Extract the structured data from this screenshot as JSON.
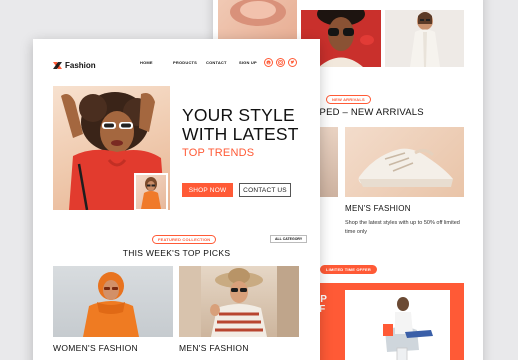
{
  "brand": {
    "name": "Fashion",
    "accent": "#ff5a36"
  },
  "nav": [
    "HOME",
    "PRODUCTS",
    "CONTACT",
    "SIGN UP"
  ],
  "socials": [
    "pinterest-icon",
    "instagram-icon",
    "twitter-icon"
  ],
  "hero": {
    "headline_line1": "YOUR STYLE",
    "headline_line2": "WITH LATEST",
    "subhead": "TOP TRENDS",
    "shop_label": "SHOP NOW",
    "contact_label": "CONTACT US"
  },
  "collection": {
    "badge": "FEATURED COLLECTION",
    "all_label": "ALL CATEGORY",
    "title": "THIS WEEK'S TOP PICKS",
    "cards": [
      {
        "label": "WOMEN'S FASHION"
      },
      {
        "label": "MEN'S FASHION"
      }
    ]
  },
  "back_page": {
    "new_badge": "NEW ARRIVALS",
    "section_title": "PPED – NEW ARRIVALS",
    "product_title": "MEN'S FASHION",
    "product_text": "Shop the latest styles with up to 50% off limited time only",
    "offer_badge": "LIMITED TIME OFFER",
    "promo_line1": "UP",
    "promo_line2": "FF"
  }
}
